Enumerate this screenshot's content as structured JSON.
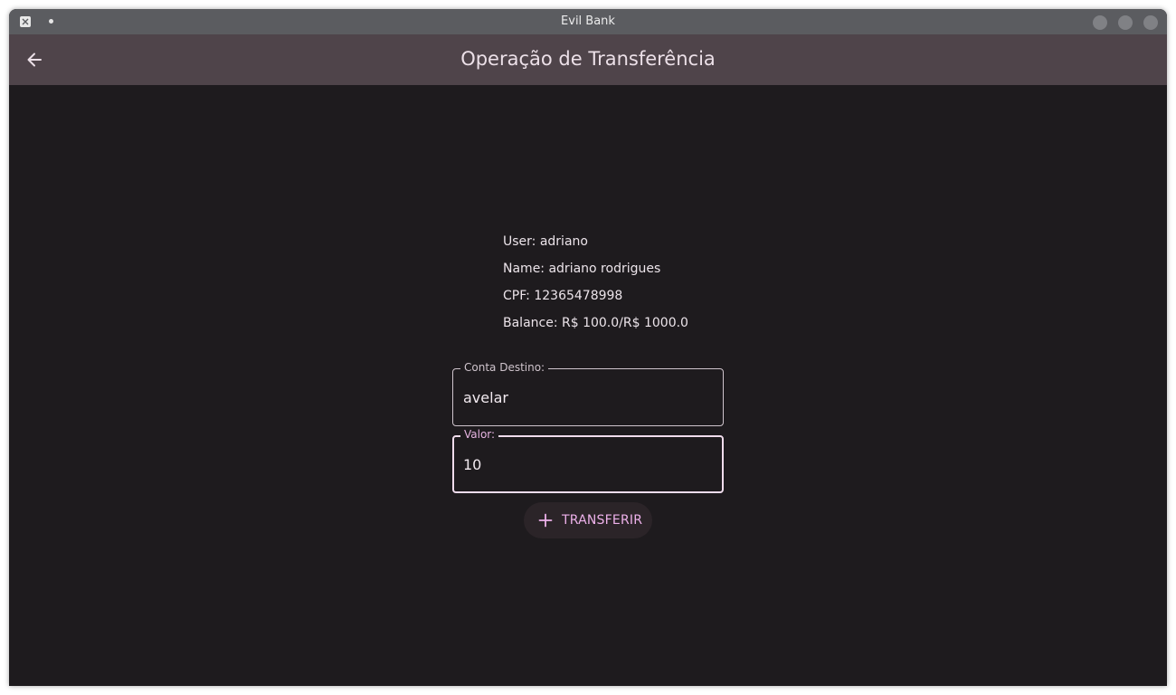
{
  "window": {
    "title": "Evil Bank",
    "icon": "x-app-icon"
  },
  "appbar": {
    "title": "Operação de Transferência",
    "back_icon": "arrow-left-icon"
  },
  "user_info": {
    "user": "User: adriano",
    "name": "Name: adriano rodrigues",
    "cpf": "CPF: 12365478998",
    "balance": "Balance: R$ 100.0/R$ 1000.0"
  },
  "form": {
    "destino_label": "Conta Destino:",
    "destino_value": "avelar",
    "valor_label": "Valor:",
    "valor_value": "10"
  },
  "action": {
    "transfer_label": "TRANSFERIR",
    "icon": "plus-icon"
  },
  "colors": {
    "background": "#1e1b1e",
    "appbar": "#4f444a",
    "accent": "#edb1ea",
    "titlebar": "#5b5c60"
  }
}
